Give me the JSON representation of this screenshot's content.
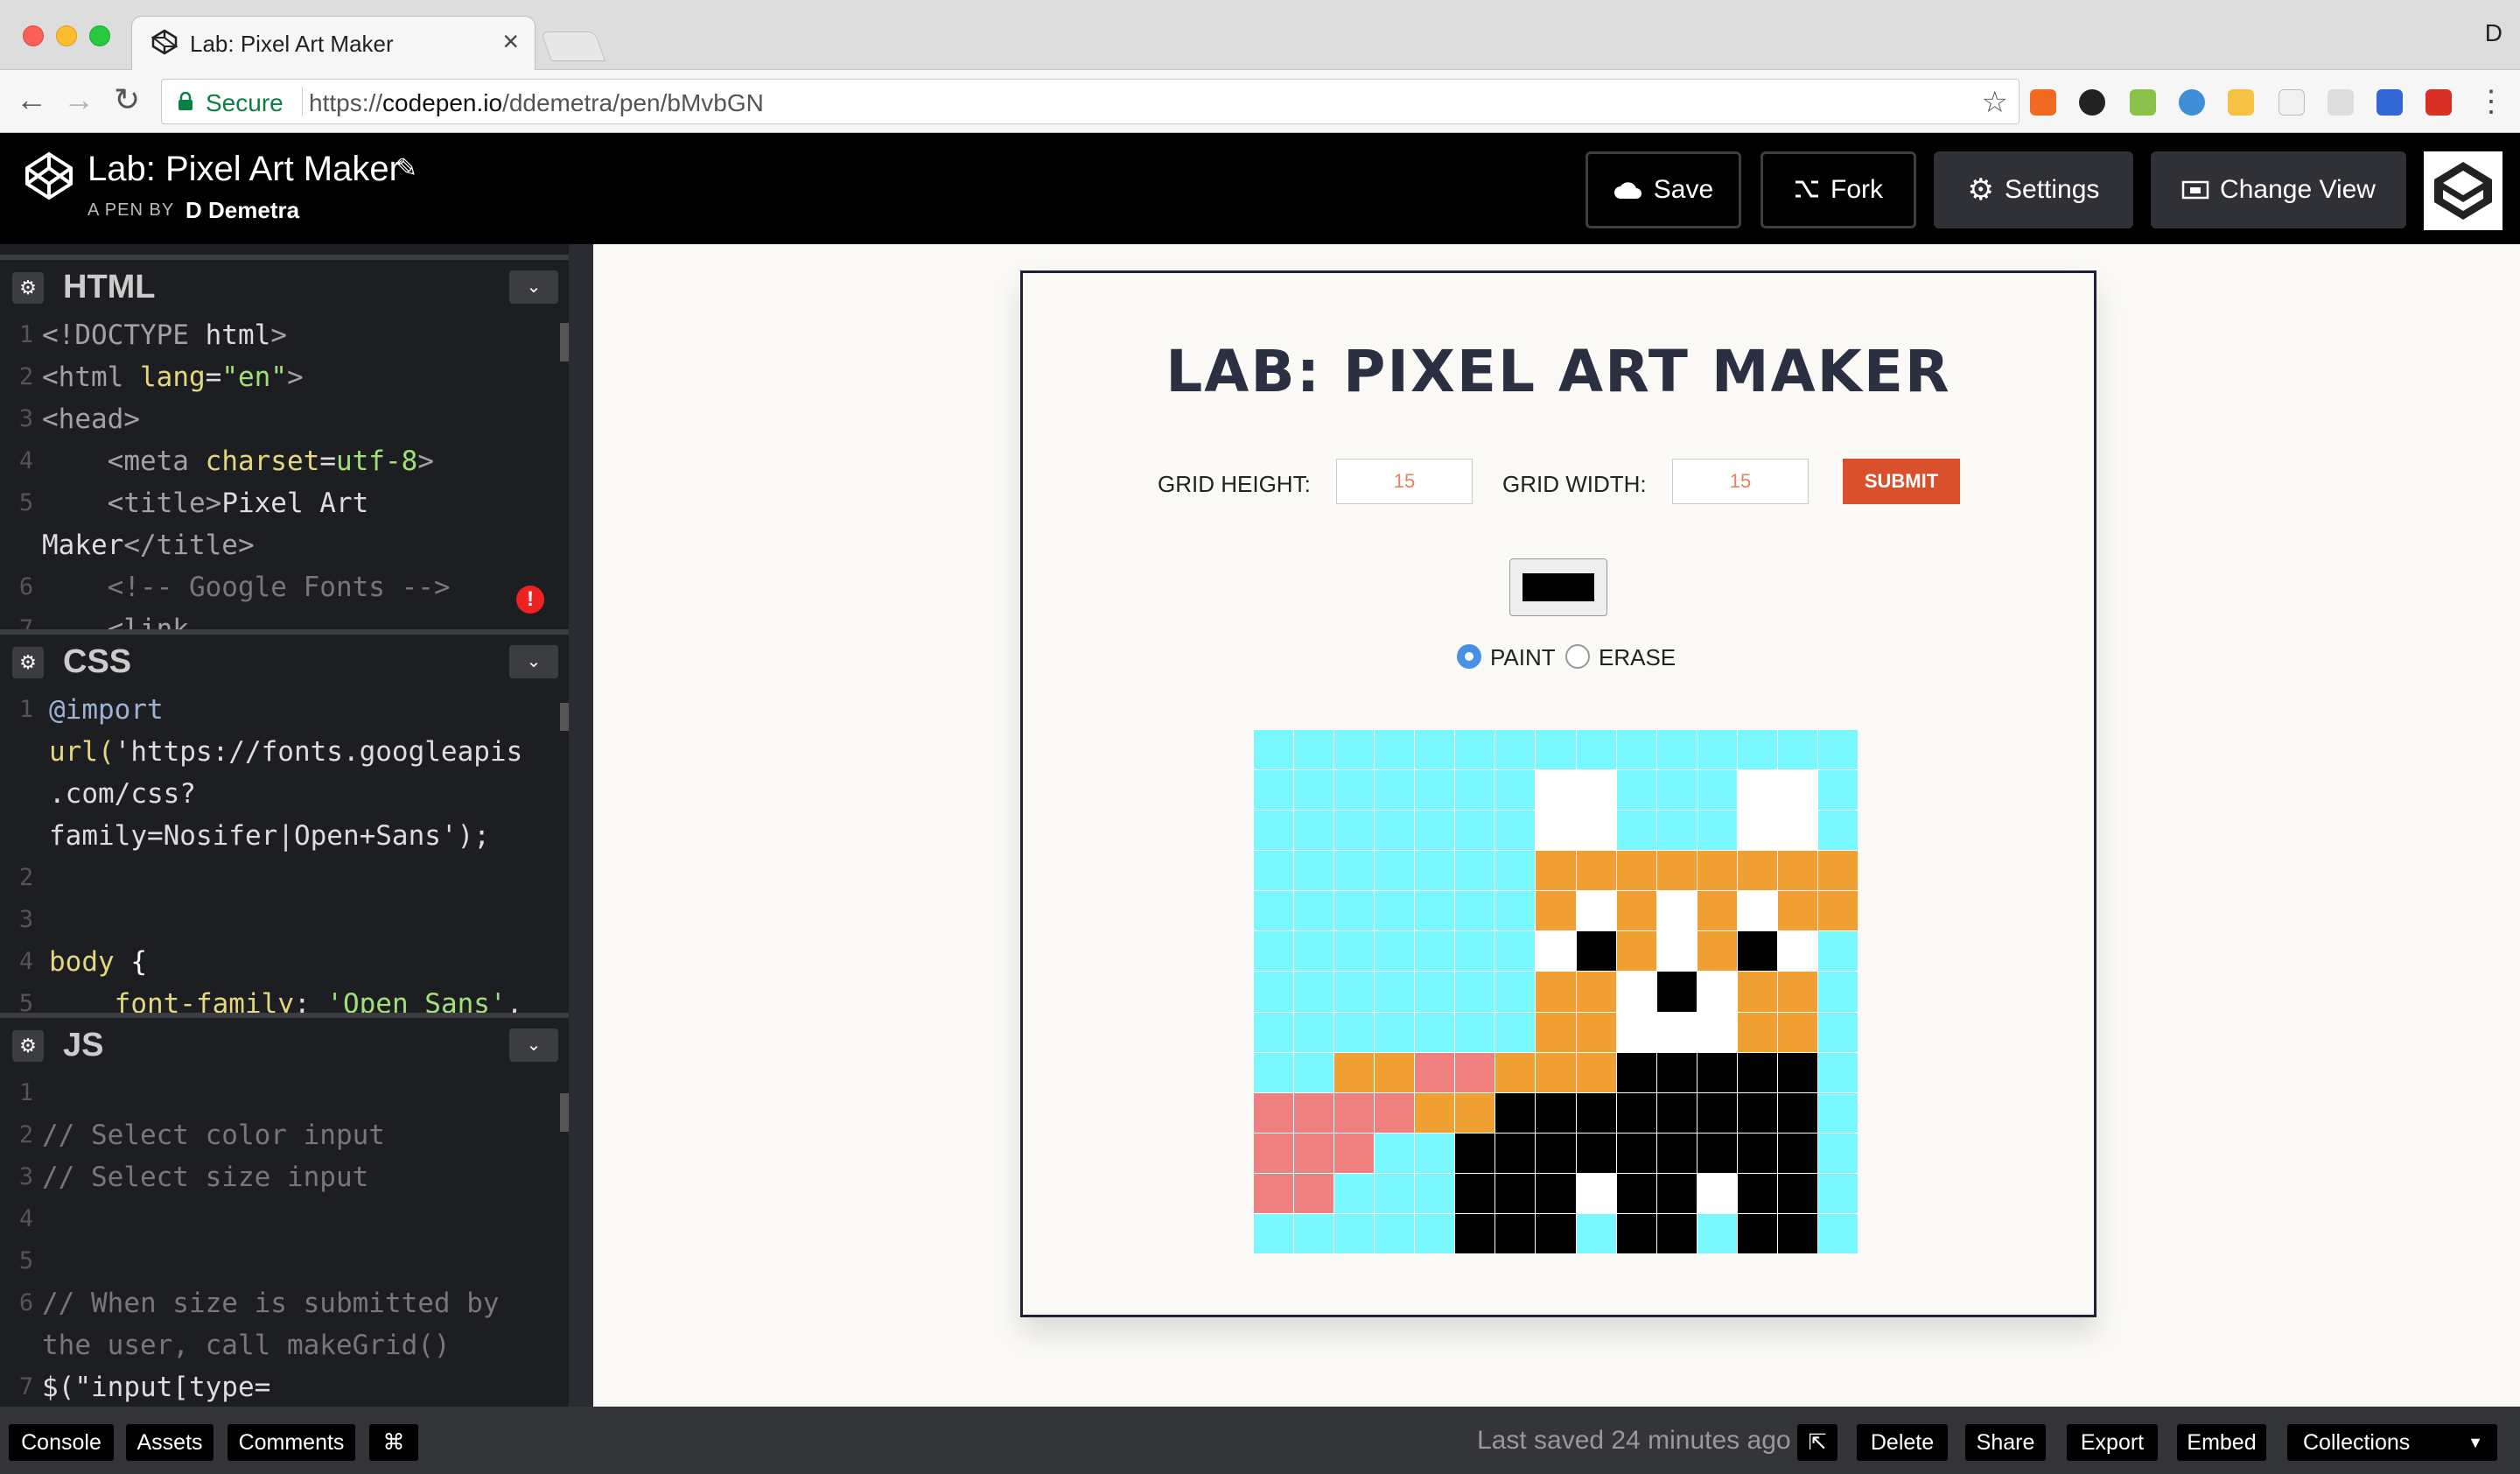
{
  "browser": {
    "tab_title": "Lab: Pixel Art Maker",
    "tab_close": "×",
    "profile_letter": "D",
    "secure_label": "Secure",
    "url_scheme": "https://",
    "url_domain": "codepen.io",
    "url_path": "/ddemetra/pen/bMvbGN"
  },
  "header": {
    "pen_title": "Lab: Pixel Art Maker",
    "pen_by": "A PEN BY",
    "author": "D Demetra",
    "save_label": "Save",
    "fork_label": "Fork",
    "settings_label": "Settings",
    "change_view_label": "Change View"
  },
  "editors": {
    "html": {
      "title": "HTML",
      "lines": [
        {
          "n": "1",
          "text": "<!DOCTYPE html>"
        },
        {
          "n": "2",
          "text": "<html lang=\"en\">"
        },
        {
          "n": "3",
          "text": "<head>"
        },
        {
          "n": "4",
          "text": "    <meta charset=utf-8>"
        },
        {
          "n": "5",
          "text": "    <title>Pixel Art"
        },
        {
          "n": "",
          "text": "Maker</title>"
        },
        {
          "n": "6",
          "text": "    <!-- Google Fonts -->"
        },
        {
          "n": "7",
          "text": "    <link"
        }
      ]
    },
    "css": {
      "title": "CSS",
      "lines": [
        {
          "n": "1",
          "text": "@import"
        },
        {
          "n": "",
          "text": "url('https://fonts.googleapis"
        },
        {
          "n": "",
          "text": ".com/css?"
        },
        {
          "n": "",
          "text": "family=Nosifer|Open+Sans');"
        },
        {
          "n": "2",
          "text": ""
        },
        {
          "n": "3",
          "text": ""
        },
        {
          "n": "4",
          "text": "body {"
        },
        {
          "n": "5",
          "text": "    font-family: 'Open Sans',"
        }
      ]
    },
    "js": {
      "title": "JS",
      "lines": [
        {
          "n": "1",
          "text": ""
        },
        {
          "n": "2",
          "text": "// Select color input"
        },
        {
          "n": "3",
          "text": "// Select size input"
        },
        {
          "n": "4",
          "text": ""
        },
        {
          "n": "5",
          "text": ""
        },
        {
          "n": "6",
          "text": "// When size is submitted by"
        },
        {
          "n": "",
          "text": "the user, call makeGrid()"
        },
        {
          "n": "7",
          "text": "$(\"input[type="
        }
      ]
    }
  },
  "preview": {
    "app_title": "LAB: PIXEL ART MAKER",
    "grid_height_label": "GRID HEIGHT:",
    "grid_height_value": "15",
    "grid_width_label": "GRID WIDTH:",
    "grid_width_value": "15",
    "submit_label": "SUBMIT",
    "selected_color": "#000000",
    "paint_label": "PAINT",
    "erase_label": "ERASE",
    "mode": "paint",
    "palette": {
      "C": "#7af8ff",
      "W": "#ffffff",
      "O": "#f0a032",
      "K": "#000000",
      "P": "#f08080"
    },
    "pixel_rows": [
      "CCCCCCCCCCCCCCC",
      "CCCCCCCWWCCCWWC",
      "CCCCCCCWWCCCWWC",
      "CCCCCCCOOOOOOOO",
      "CCCCCCCOWOWOWOO",
      "CCCCCCCWKOWOKWC",
      "CCCCCCCOOWKWOOC",
      "CCCCCCCOOWWWOOC",
      "CCOOPPOOOKKKKKC",
      "PPPPOOKKKKKKKKC",
      "PPPCCKKKKKKKKKC",
      "PPCCCKKKWKKWKKC",
      "CCCCCKKKCKKCKKC"
    ]
  },
  "bottombar": {
    "console_label": "Console",
    "assets_label": "Assets",
    "comments_label": "Comments",
    "shortcuts_label": "⌘",
    "last_saved": "Last saved 24 minutes ago",
    "delete_label": "Delete",
    "share_label": "Share",
    "export_label": "Export",
    "embed_label": "Embed",
    "collections_label": "Collections"
  }
}
